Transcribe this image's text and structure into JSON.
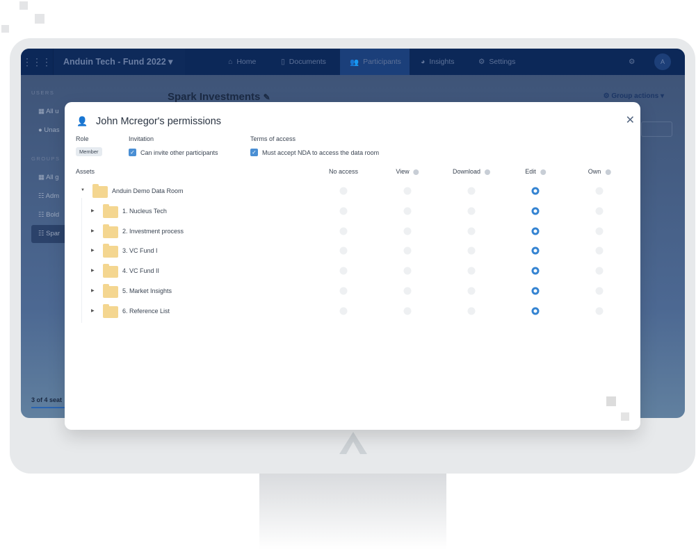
{
  "topbar": {
    "fund": "Anduin Tech - Fund 2022",
    "nav": [
      "Home",
      "Documents",
      "Participants",
      "Insights",
      "Settings"
    ],
    "active": "Participants",
    "avatar": "A"
  },
  "sidebar": {
    "users_header": "USERS",
    "users": [
      "All u",
      "Unas"
    ],
    "groups_header": "GROUPS",
    "groups": [
      "All g",
      "Adm",
      "Bold",
      "Spar"
    ],
    "seats": "3 of 4 seat"
  },
  "page": {
    "title": "Spark Investments",
    "group_actions": "Group actions"
  },
  "modal": {
    "title": "John Mcregor's permissions",
    "role_label": "Role",
    "role": "Member",
    "invitation_label": "Invitation",
    "invitation_option": "Can invite other participants",
    "invitation_checked": true,
    "terms_label": "Terms of access",
    "terms_option": "Must accept NDA to access the data room",
    "terms_checked": true,
    "assets_label": "Assets",
    "columns": [
      "No access",
      "View",
      "Download",
      "Edit",
      "Own"
    ],
    "root": {
      "name": "Anduin Demo Data Room",
      "permission": "Edit"
    },
    "folders": [
      {
        "name": "1. Nucleus Tech",
        "permission": "Edit"
      },
      {
        "name": "2. Investment process",
        "permission": "Edit"
      },
      {
        "name": "3. VC Fund I",
        "permission": "Edit"
      },
      {
        "name": "4. VC Fund II",
        "permission": "Edit"
      },
      {
        "name": "5. Market Insights",
        "permission": "Edit"
      },
      {
        "name": "6. Reference List",
        "permission": "Edit"
      }
    ]
  },
  "colors": {
    "accent": "#3584d2",
    "navbar": "#0c2858",
    "folder": "#f4d690"
  }
}
